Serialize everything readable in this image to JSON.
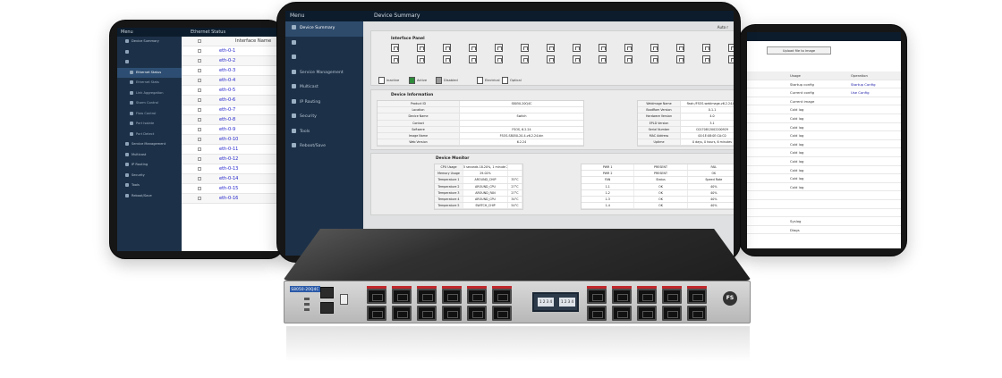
{
  "left_screen": {
    "menu_title": "Menu",
    "section_title": "Ethernet Status",
    "column_header": "Interface Name",
    "menu_items": [
      {
        "label": "Device Summary",
        "sub": false,
        "active": false
      },
      {
        "label": "",
        "sub": false,
        "active": false
      },
      {
        "label": "",
        "sub": false,
        "active": false
      },
      {
        "label": "Ethernet Status",
        "sub": true,
        "active": true
      },
      {
        "label": "Ethernet Stats",
        "sub": true,
        "active": false
      },
      {
        "label": "Link Aggregation",
        "sub": true,
        "active": false
      },
      {
        "label": "Storm Control",
        "sub": true,
        "active": false
      },
      {
        "label": "Flow Control",
        "sub": true,
        "active": false
      },
      {
        "label": "Port Isolate",
        "sub": true,
        "active": false
      },
      {
        "label": "Port Detect",
        "sub": true,
        "active": false
      },
      {
        "label": "Service Management",
        "sub": false,
        "active": false
      },
      {
        "label": "Multicast",
        "sub": false,
        "active": false
      },
      {
        "label": "IP Routing",
        "sub": false,
        "active": false
      },
      {
        "label": "Security",
        "sub": false,
        "active": false
      },
      {
        "label": "Tools",
        "sub": false,
        "active": false
      },
      {
        "label": "Reboot/Save",
        "sub": false,
        "active": false
      }
    ],
    "interfaces": [
      "eth-0-1",
      "eth-0-2",
      "eth-0-3",
      "eth-0-4",
      "eth-0-5",
      "eth-0-6",
      "eth-0-7",
      "eth-0-8",
      "eth-0-9",
      "eth-0-10",
      "eth-0-11",
      "eth-0-12",
      "eth-0-13",
      "eth-0-14",
      "eth-0-15",
      "eth-0-16"
    ]
  },
  "main_screen": {
    "menu_title": "Menu",
    "page_title": "Device Summary",
    "auto_label": "Auto r",
    "menu_items": [
      {
        "label": "Device Summary",
        "active": true
      },
      {
        "label": "",
        "active": false
      },
      {
        "label": "",
        "active": false
      },
      {
        "label": "Service Management",
        "active": false
      },
      {
        "label": "Multicast",
        "active": false
      },
      {
        "label": "IP Routing",
        "active": false
      },
      {
        "label": "Security",
        "active": false
      },
      {
        "label": "Tools",
        "active": false
      },
      {
        "label": "Reboot/Save",
        "active": false
      }
    ],
    "interface_panel": {
      "title": "Interface Panel",
      "legend": [
        {
          "label": "Inactive",
          "color": "#ffffff"
        },
        {
          "label": "Active",
          "color": "#2e8b3a"
        },
        {
          "label": "Disabled",
          "color": "#9a9a9a"
        },
        {
          "label": "Electrical",
          "color": "#ffffff"
        },
        {
          "label": "Optical",
          "color": "#ffffff"
        }
      ]
    },
    "device_information": {
      "title": "Device Information",
      "left": [
        {
          "k": "Product ID",
          "v": "S8050-20Q4C"
        },
        {
          "k": "Location",
          "v": ""
        },
        {
          "k": "Device Name",
          "v": "Switch"
        },
        {
          "k": "Contact",
          "v": ""
        },
        {
          "k": "Software",
          "v": "FSOS, 6.2.24"
        },
        {
          "k": "Image Name",
          "v": "FSOS-S8050-20-4-v6.2.24.bin"
        },
        {
          "k": "Web Version",
          "v": "6.2.24"
        }
      ],
      "right": [
        {
          "k": "WebImage Name",
          "v": "flash:/FSOS-webImage-v6.2.24.bin"
        },
        {
          "k": "BootRom Version",
          "v": "0.1.1"
        },
        {
          "k": "Hardware Version",
          "v": "4.0"
        },
        {
          "k": "EPLD Version",
          "v": "3.1"
        },
        {
          "k": "Serial Number",
          "v": "C0170812002200929"
        },
        {
          "k": "MAC Address",
          "v": "00:1E:08:0E:CA:C0"
        },
        {
          "k": "Uptime",
          "v": "0 days, 0 hours, 6 minutes"
        }
      ]
    },
    "device_monitor": {
      "title": "Device Monitor",
      "sensors": [
        [
          "CPU Usage",
          "5 seconds 18.20%, 1 minute 2.69%",
          ""
        ],
        [
          "Memory Usage",
          "29.02%",
          ""
        ],
        [
          "Temperature 1",
          "AROUND_CHIP",
          "35°C"
        ],
        [
          "Temperature 2",
          "AROUND_CPU",
          "27°C"
        ],
        [
          "Temperature 3",
          "AROUND_FAN",
          "27°C"
        ],
        [
          "Temperature 4",
          "AROUND_CPU",
          "34°C"
        ],
        [
          "Temperature 5",
          "SWITCH_CHIP",
          "54°C"
        ]
      ],
      "psu_fan": [
        [
          "PWR 1",
          "PRESENT",
          "FAIL"
        ],
        [
          "PWR 2",
          "PRESENT",
          "OK"
        ],
        [
          "FAN",
          "Status",
          "Speed Rate"
        ],
        [
          "1-1",
          "OK",
          "40%"
        ],
        [
          "1-2",
          "OK",
          "40%"
        ],
        [
          "1-3",
          "OK",
          "40%"
        ],
        [
          "1-4",
          "OK",
          "40%"
        ]
      ]
    }
  },
  "right_screen": {
    "upload_button": "Upload file to image",
    "column_headers": [
      "Usage",
      "Operation"
    ],
    "rows": [
      {
        "usage": "Startup config",
        "op": "Startup Config"
      },
      {
        "usage": "Current config",
        "op": "Use Config"
      },
      {
        "usage": "Current image",
        "op": ""
      },
      {
        "usage": "Cold log",
        "op": ""
      },
      {
        "usage": "Cold log",
        "op": ""
      },
      {
        "usage": "Cold log",
        "op": ""
      },
      {
        "usage": "Cold log",
        "op": ""
      },
      {
        "usage": "Cold log",
        "op": ""
      },
      {
        "usage": "Cold log",
        "op": ""
      },
      {
        "usage": "Cold log",
        "op": ""
      },
      {
        "usage": "Cold log",
        "op": ""
      },
      {
        "usage": "Cold log",
        "op": ""
      },
      {
        "usage": "Cold log",
        "op": ""
      },
      {
        "usage": "",
        "op": ""
      },
      {
        "usage": "",
        "op": ""
      },
      {
        "usage": "",
        "op": ""
      },
      {
        "usage": "Syslog",
        "op": ""
      },
      {
        "usage": "Diags",
        "op": ""
      }
    ]
  },
  "switch": {
    "model_label": "S8050-20Q4C",
    "brand": "FS",
    "qsfp_labels": [
      "1 2 3 4",
      "1 2 3 4"
    ],
    "colors": {
      "label_blue": "#2b5aa8",
      "port_red": "#c0282d",
      "chassis": "#1e1e1e"
    }
  }
}
